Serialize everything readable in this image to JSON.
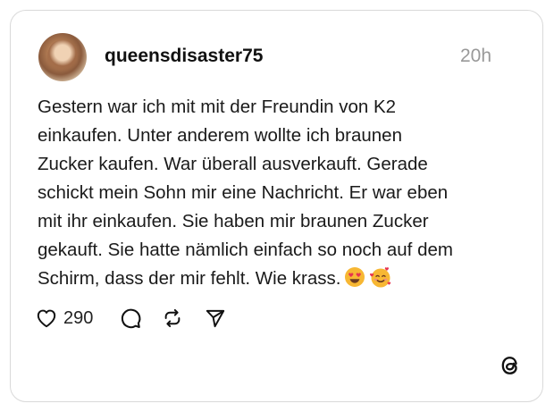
{
  "post": {
    "username": "queensdisaster75",
    "time": "20h",
    "text_lines": [
      "Gestern war ich mit mit der Freundin von K2",
      "einkaufen. Unter anderem wollte ich braunen",
      "Zucker kaufen. War überall ausverkauft. Gerade",
      "schickt mein Sohn mir eine Nachricht. Er war eben",
      "mit ihr einkaufen. Sie haben mir braunen Zucker",
      "gekauft. Sie hatte nämlich einfach so noch auf dem",
      "Schirm, dass der mir fehlt. Wie krass."
    ],
    "emojis": [
      "heart-eyes-emoji",
      "smiling-face-with-hearts-emoji"
    ],
    "like_count": "290"
  },
  "icons": {
    "like": "heart-icon",
    "reply": "comment-icon",
    "repost": "repost-icon",
    "share": "send-icon",
    "brand": "threads-logo-icon"
  },
  "colors": {
    "text": "#111111",
    "muted": "#999999",
    "border": "#d9d9d9",
    "emoji_face": "#f7b733",
    "emoji_heart": "#e8344e"
  }
}
